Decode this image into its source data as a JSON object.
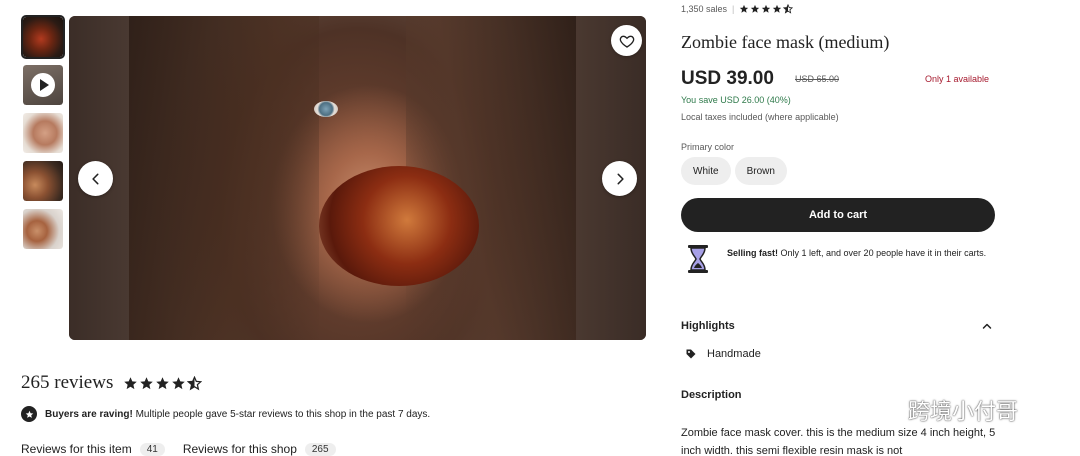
{
  "gallery": {
    "thumbnails": [
      {
        "kind": "image",
        "active": true
      },
      {
        "kind": "video",
        "active": false
      },
      {
        "kind": "image",
        "active": false
      },
      {
        "kind": "image",
        "active": false
      },
      {
        "kind": "image",
        "active": false
      }
    ],
    "icons": {
      "favorite": "heart-icon",
      "prev": "chevron-left-icon",
      "next": "chevron-right-icon",
      "video": "play-icon"
    }
  },
  "product": {
    "sales": "1,350 sales",
    "rating": 4.5,
    "title": "Zombie face mask (medium)",
    "price": "USD 39.00",
    "original_price": "USD 65.00",
    "availability": "Only 1 available",
    "savings": "You save USD 26.00 (40%)",
    "taxes": "Local taxes included (where applicable)",
    "color_label": "Primary color",
    "colors": [
      "White",
      "Brown"
    ],
    "cart_button": "Add to cart",
    "selling_fast_bold": "Selling fast!",
    "selling_fast_text": " Only 1 left, and over 20 people have it in their carts.",
    "highlights_label": "Highlights",
    "highlights": [
      "Handmade"
    ],
    "description_label": "Description",
    "description": "Zombie face mask cover. this is the medium size 4 inch height, 5 inch width. this semi flexible resin mask is not"
  },
  "reviews": {
    "count_label": "265 reviews",
    "rating": 4.5,
    "raving_bold": "Buyers are raving!",
    "raving_text": " Multiple people gave 5-star reviews to this shop in the past 7 days.",
    "tabs": [
      {
        "label": "Reviews for this item",
        "count": "41"
      },
      {
        "label": "Reviews for this shop",
        "count": "265"
      }
    ]
  },
  "watermark": {
    "text": "跨境小付哥",
    "icon": "wechat-icon"
  },
  "colors": {
    "accent": "#222222",
    "availability": "#a61a2e",
    "savings": "#2f7a4b"
  }
}
